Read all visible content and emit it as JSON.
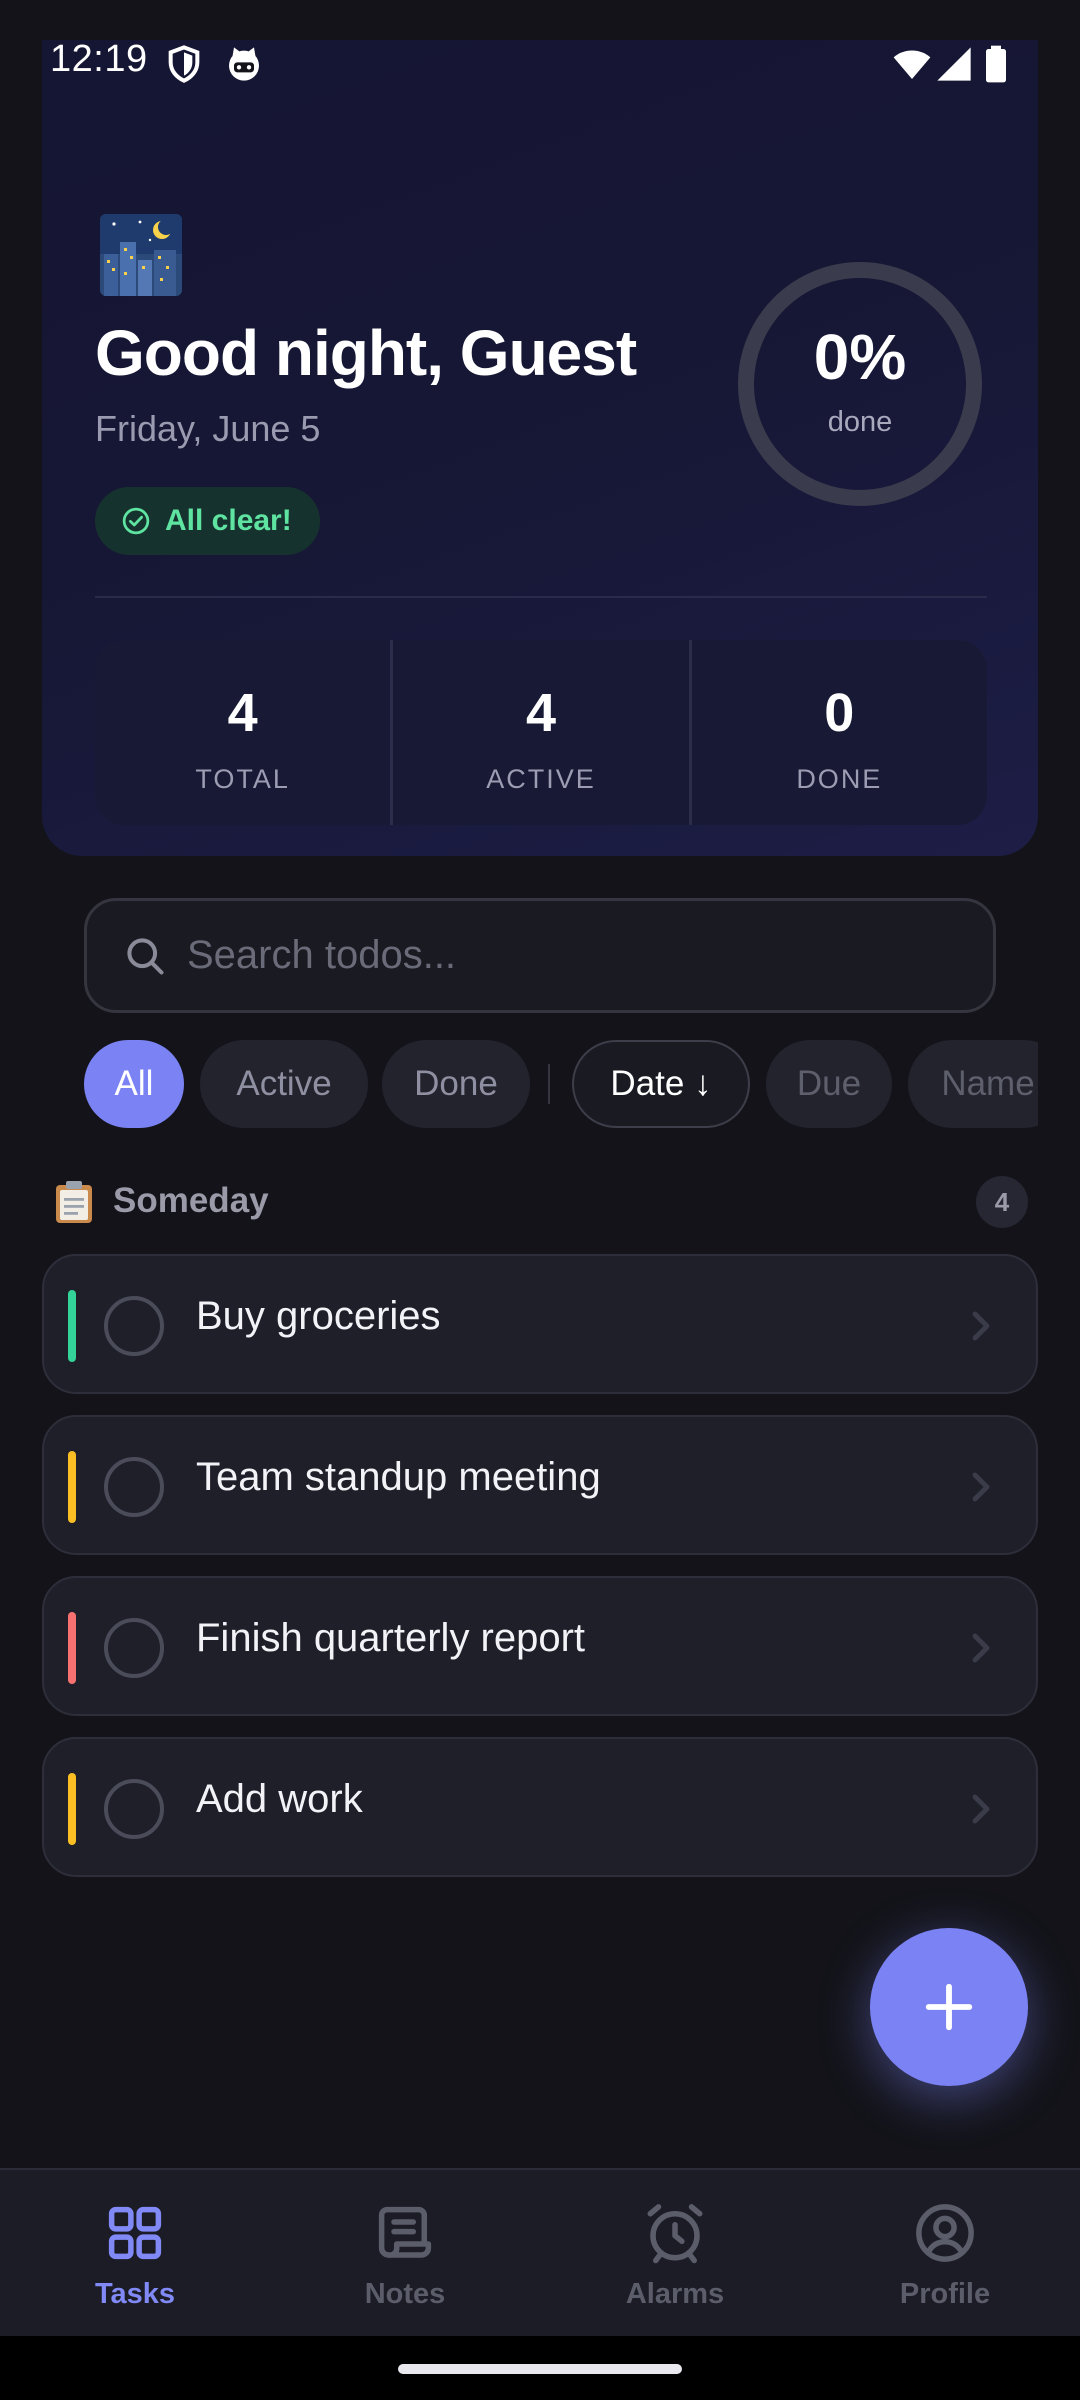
{
  "status_bar": {
    "time": "12:19",
    "icons": [
      "shield-icon",
      "cat-notification-icon",
      "wifi-icon",
      "signal-icon",
      "battery-icon"
    ]
  },
  "hero": {
    "emoji_icon": "night-city-icon",
    "greeting": "Good night, Guest",
    "date": "Friday, June 5",
    "badge_label": "All clear!",
    "progress": {
      "value": "0%",
      "label": "done",
      "fraction": 0
    },
    "stats": [
      {
        "value": "4",
        "label": "TOTAL"
      },
      {
        "value": "4",
        "label": "ACTIVE"
      },
      {
        "value": "0",
        "label": "DONE"
      }
    ]
  },
  "search": {
    "placeholder": "Search todos..."
  },
  "filters": {
    "chips": [
      "All",
      "Active",
      "Done"
    ],
    "selected": "All",
    "sort_chips": [
      "Date ↓",
      "Due",
      "Name"
    ],
    "sort_selected": "Date ↓"
  },
  "section": {
    "icon": "clipboard-icon",
    "title": "Someday",
    "count": "4"
  },
  "tasks": [
    {
      "title": "Buy groceries",
      "color": "#34d399"
    },
    {
      "title": "Team standup meeting",
      "color": "#fbbf24"
    },
    {
      "title": "Finish quarterly report",
      "color": "#f87171"
    },
    {
      "title": "Add work",
      "color": "#fbbf24"
    }
  ],
  "nav": {
    "items": [
      {
        "label": "Tasks",
        "icon": "grid-icon",
        "active": true
      },
      {
        "label": "Notes",
        "icon": "scroll-icon",
        "active": false
      },
      {
        "label": "Alarms",
        "icon": "alarm-icon",
        "active": false
      },
      {
        "label": "Profile",
        "icon": "user-icon",
        "active": false
      }
    ]
  },
  "colors": {
    "accent": "#7b83f4",
    "background": "#131319",
    "card": "#1e1f29",
    "success": "#5ee3a1"
  }
}
